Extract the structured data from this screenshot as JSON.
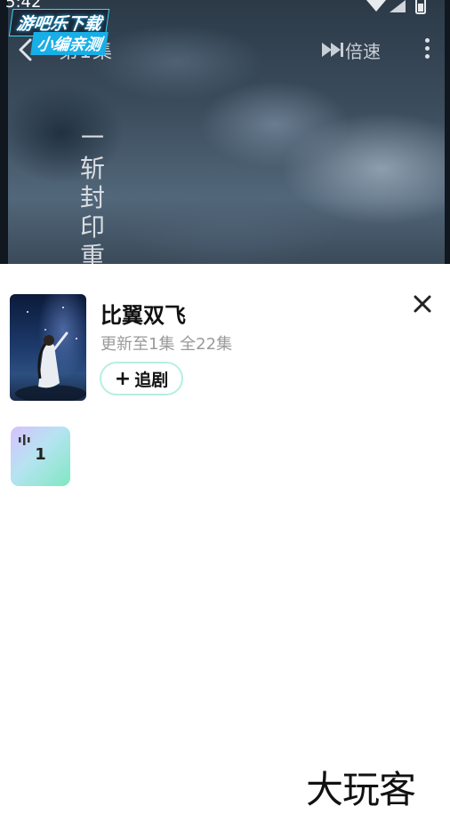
{
  "status_bar": {
    "time": "5:42"
  },
  "watermark": {
    "line1": "游吧乐下载",
    "line2": "小编亲测"
  },
  "player": {
    "episode_title": "第1集",
    "speed_label": "倍速",
    "subtitle_chars": [
      "一",
      "斩",
      "封",
      "印",
      "重"
    ]
  },
  "drama": {
    "title": "比翼双飞",
    "update_info": "更新至1集  全22集",
    "follow_label": "追剧"
  },
  "episodes": [
    {
      "number": "1",
      "playing": true
    }
  ],
  "brand_watermark": "大玩客",
  "icons": {
    "back": "chevron-left-icon",
    "speed": "fast-forward-icon",
    "more": "more-vertical-icon",
    "close": "close-icon",
    "plus": "plus-icon",
    "playing": "equalizer-icon"
  },
  "colors": {
    "follow_border": "#b6efe3",
    "episode_tile_gradient": [
      "#d6c1ff",
      "#7fe8c1"
    ],
    "watermark_accent": "#18aee6"
  }
}
